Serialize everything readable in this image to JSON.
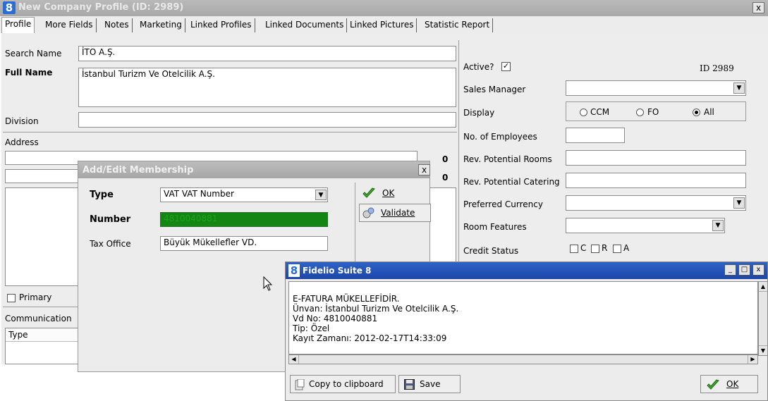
{
  "main_window": {
    "logo": "8",
    "title": "New Company Profile (ID: 2989)",
    "close_label": "x"
  },
  "tabs": [
    {
      "label": "Profile"
    },
    {
      "label": "More Fields"
    },
    {
      "label": "Notes"
    },
    {
      "label": "Marketing"
    },
    {
      "label": "Linked Profiles"
    },
    {
      "label": "Linked Documents"
    },
    {
      "label": "Linked Pictures"
    },
    {
      "label": "Statistic Report"
    }
  ],
  "profile": {
    "search_name_label": "Search Name",
    "search_name_value": "İTO A.Ş.",
    "full_name_label": "Full Name",
    "full_name_value": "İstanbul Turizm Ve Otelcilik A.Ş.",
    "division_label": "Division",
    "division_value": "",
    "address_label": "Address",
    "address_counter_1": "0",
    "address_counter_2": "0",
    "primary_label": "Primary",
    "communication_label": "Communication",
    "type_header": "Type"
  },
  "right_panel": {
    "active_label": "Active?",
    "active_checked": "✓",
    "id_text": "ID 2989",
    "sales_manager_label": "Sales Manager",
    "display_label": "Display",
    "display_options": [
      "CCM",
      "FO",
      "All"
    ],
    "display_selected": "All",
    "employees_label": "No. of Employees",
    "rev_rooms_label": "Rev. Potential Rooms",
    "rev_catering_label": "Rev. Potential Catering",
    "currency_label": "Preferred Currency",
    "room_features_label": "Room Features",
    "credit_status_label": "Credit Status",
    "credit_options": [
      "C",
      "R",
      "A"
    ]
  },
  "membership_dialog": {
    "title": "Add/Edit Membership",
    "close_label": "x",
    "type_label": "Type",
    "type_value": "VAT VAT Number",
    "number_label": "Number",
    "number_value": "4810040881",
    "tax_office_label": "Tax Office",
    "tax_office_value": "Büyük Mükellefler VD.",
    "ok_label": "OK",
    "validate_label": "Validate"
  },
  "fidelio_window": {
    "logo": "8",
    "title": "Fidelio Suite 8",
    "message_lines": [
      "E-FATURA MÜKELLEFİDİR.",
      "Ünvan: İstanbul Turizm Ve Otelcilik A.Ş.",
      "Vd No: 4810040881",
      "Tip: Özel",
      "Kayıt Zamanı: 2012-02-17T14:33:09"
    ],
    "copy_label": "Copy to clipboard",
    "save_label": "Save",
    "ok_label": "OK"
  },
  "colors": {
    "number_field_bg": "#128512",
    "title_active": "#1c46a8",
    "title_inactive": "#a9a9a9"
  }
}
